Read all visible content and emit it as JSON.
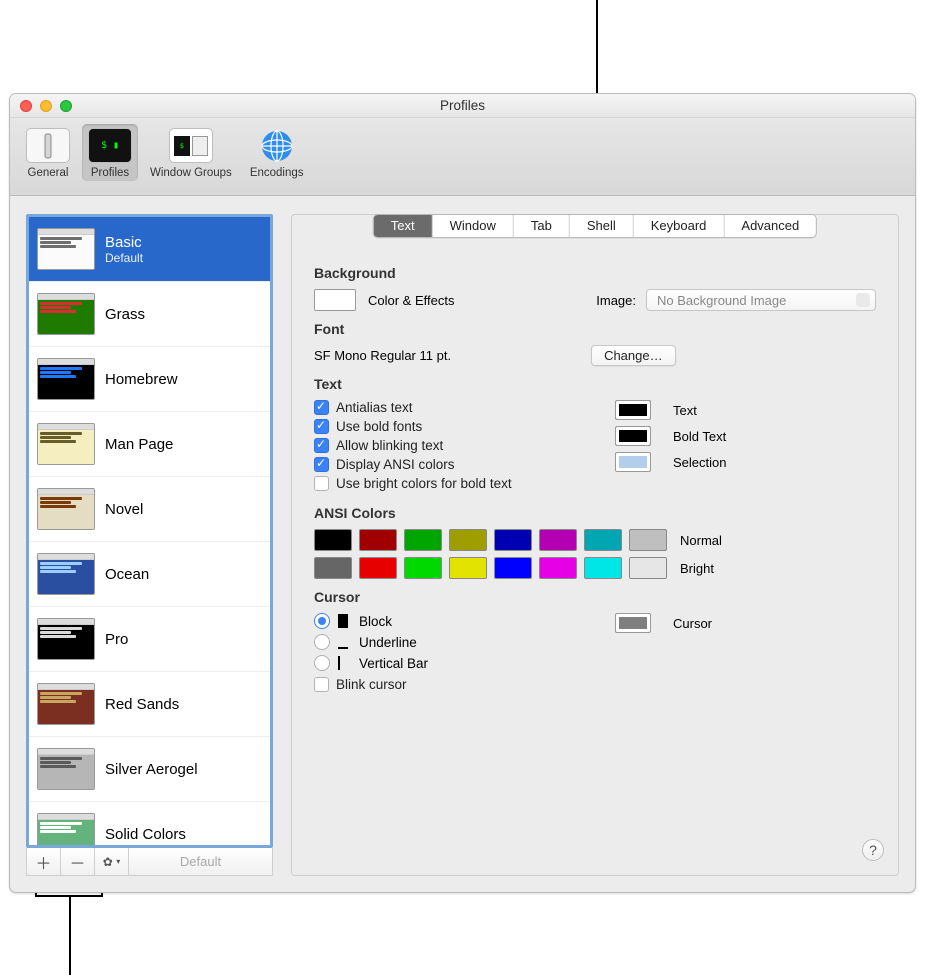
{
  "window_title": "Profiles",
  "toolbar": {
    "items": [
      {
        "label": "General"
      },
      {
        "label": "Profiles"
      },
      {
        "label": "Window Groups"
      },
      {
        "label": "Encodings"
      }
    ]
  },
  "sidebar": {
    "profiles": [
      {
        "name": "Basic",
        "subtitle": "Default",
        "selected": true,
        "bg": "#fbfbfb",
        "bar": "#6e6e6e"
      },
      {
        "name": "Grass",
        "bg": "#1f7a00",
        "bar": "#d62f2f"
      },
      {
        "name": "Homebrew",
        "bg": "#000000",
        "bar": "#2078ff"
      },
      {
        "name": "Man Page",
        "bg": "#f5eec0",
        "bar": "#675d2b"
      },
      {
        "name": "Novel",
        "bg": "#e4ddc3",
        "bar": "#7a390a"
      },
      {
        "name": "Ocean",
        "bg": "#2a4fa1",
        "bar": "#9ccfff"
      },
      {
        "name": "Pro",
        "bg": "#000000",
        "bar": "#d9d9d9"
      },
      {
        "name": "Red Sands",
        "bg": "#7a2f20",
        "bar": "#c9a562"
      },
      {
        "name": "Silver Aerogel",
        "bg": "#b6b6b6",
        "bar": "#5a5a5a"
      },
      {
        "name": "Solid Colors",
        "bg": "#64b27c",
        "bar": "#ffffff"
      }
    ],
    "footer": {
      "default_label": "Default"
    }
  },
  "tabs": [
    "Text",
    "Window",
    "Tab",
    "Shell",
    "Keyboard",
    "Advanced"
  ],
  "active_tab": "Text",
  "background": {
    "title": "Background",
    "color_effects_label": "Color & Effects",
    "image_label": "Image:",
    "image_value": "No Background Image"
  },
  "font": {
    "title": "Font",
    "value": "SF Mono Regular 11 pt.",
    "change_label": "Change…"
  },
  "text": {
    "title": "Text",
    "options": {
      "antialias": "Antialias text",
      "bold_fonts": "Use bold fonts",
      "blinking": "Allow blinking text",
      "ansi": "Display ANSI colors",
      "bright_bold": "Use bright colors for bold text"
    },
    "swatches": {
      "text_label": "Text",
      "bold_label": "Bold Text",
      "selection_label": "Selection",
      "text_color": "#000000",
      "bold_color": "#000000",
      "selection_color": "#b3cdec"
    }
  },
  "ansi": {
    "title": "ANSI Colors",
    "normal_label": "Normal",
    "bright_label": "Bright",
    "normal": [
      "#000000",
      "#a10000",
      "#00a600",
      "#9e9e00",
      "#0000b3",
      "#b200b2",
      "#00a6b2",
      "#bfbfbf"
    ],
    "bright": [
      "#666666",
      "#e60000",
      "#00d900",
      "#e3e300",
      "#0000ff",
      "#e600e6",
      "#00e6e6",
      "#e6e6e6"
    ]
  },
  "cursor": {
    "title": "Cursor",
    "block_label": "Block",
    "underline_label": "Underline",
    "vertical_label": "Vertical Bar",
    "blink_label": "Blink cursor",
    "swatch_label": "Cursor",
    "swatch_color": "#7f7f7f"
  }
}
